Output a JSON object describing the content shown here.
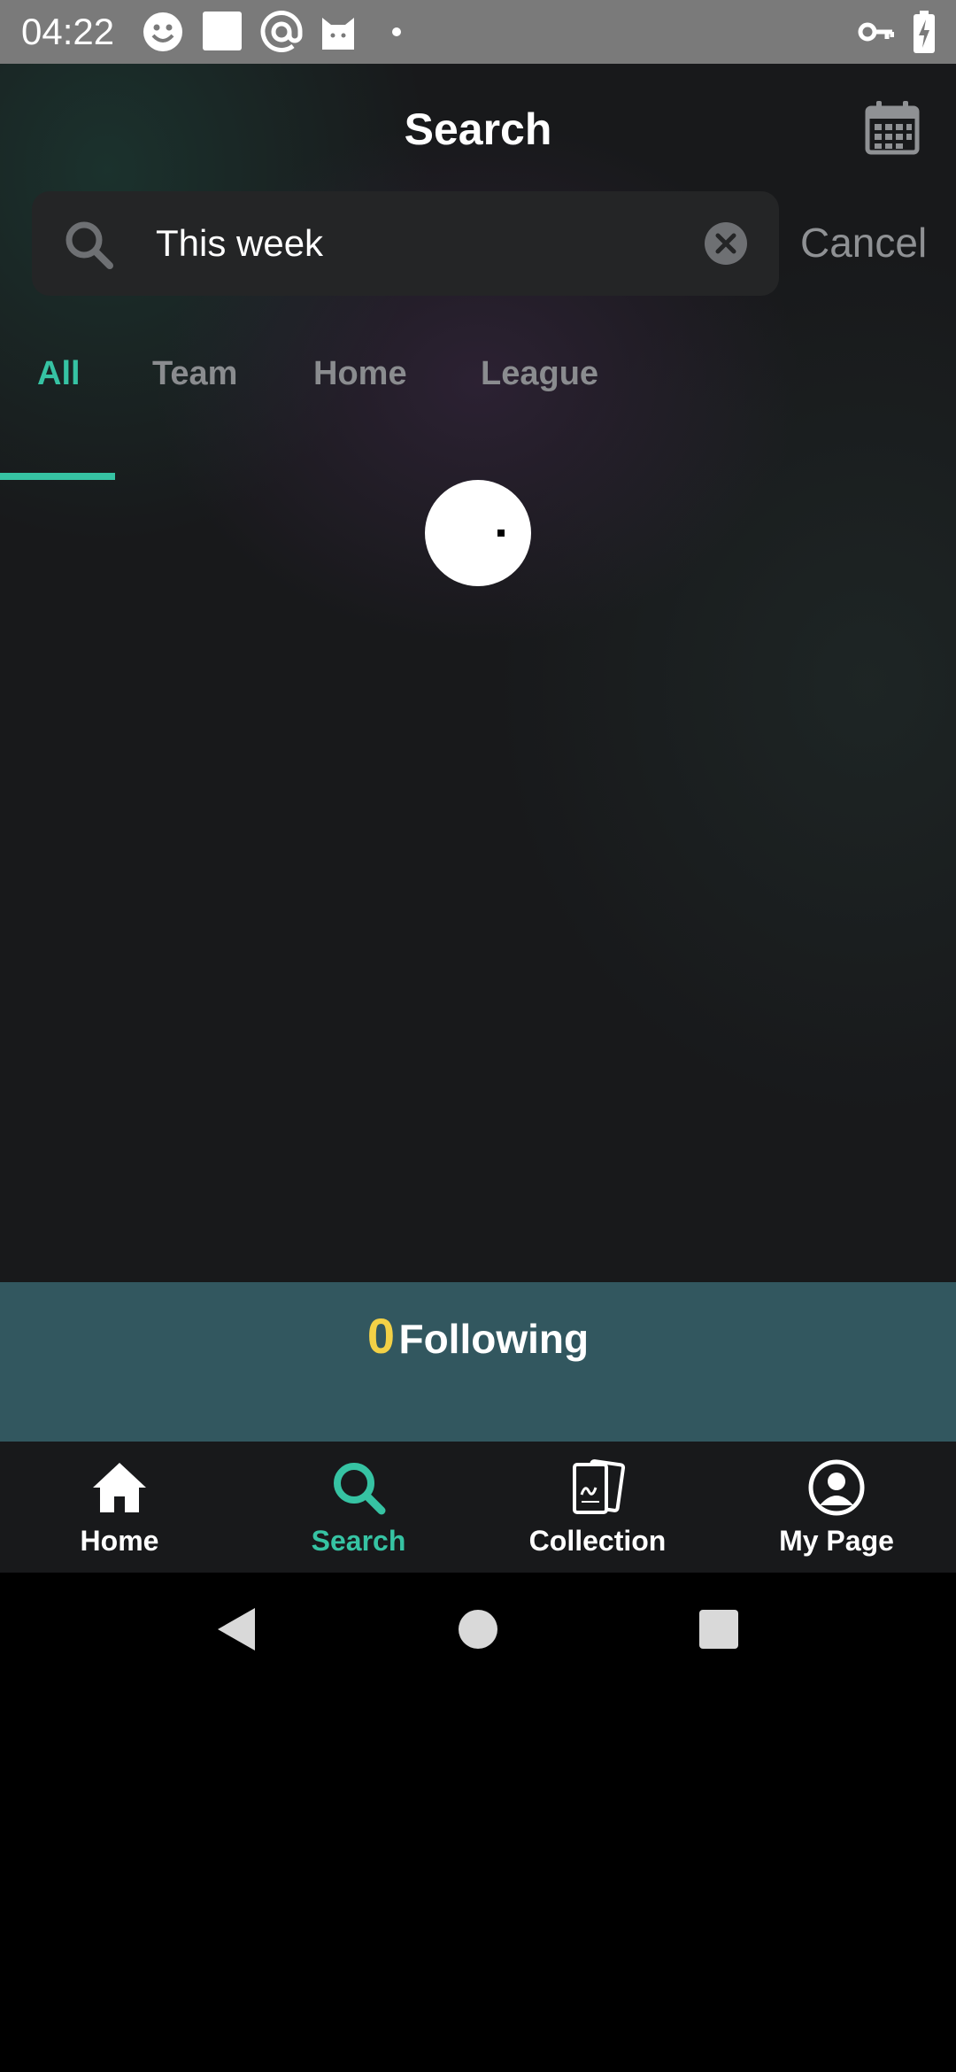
{
  "status_bar": {
    "time": "04:22",
    "left_icons": [
      "smiley-icon",
      "square-icon",
      "at-icon",
      "cat-icon",
      "dot-icon"
    ],
    "right_icons": [
      "key-icon",
      "battery-charging-icon"
    ]
  },
  "header": {
    "title": "Search",
    "calendar_icon": "calendar-icon"
  },
  "search": {
    "value": "This week",
    "placeholder": "",
    "cancel_label": "Cancel"
  },
  "tabs": [
    {
      "label": "All",
      "active": true
    },
    {
      "label": "Team",
      "active": false
    },
    {
      "label": "Home",
      "active": false
    },
    {
      "label": "League",
      "active": false
    }
  ],
  "following": {
    "count": "0",
    "label": "Following"
  },
  "bottom_nav": [
    {
      "label": "Home",
      "icon": "home-icon",
      "active": false
    },
    {
      "label": "Search",
      "icon": "search-icon",
      "active": true
    },
    {
      "label": "Collection",
      "icon": "collection-icon",
      "active": false
    },
    {
      "label": "My Page",
      "icon": "profile-icon",
      "active": false
    }
  ],
  "colors": {
    "accent": "#36c3a3",
    "following_count": "#f3d146",
    "following_bar": "#32575f",
    "background": "#18191b"
  }
}
